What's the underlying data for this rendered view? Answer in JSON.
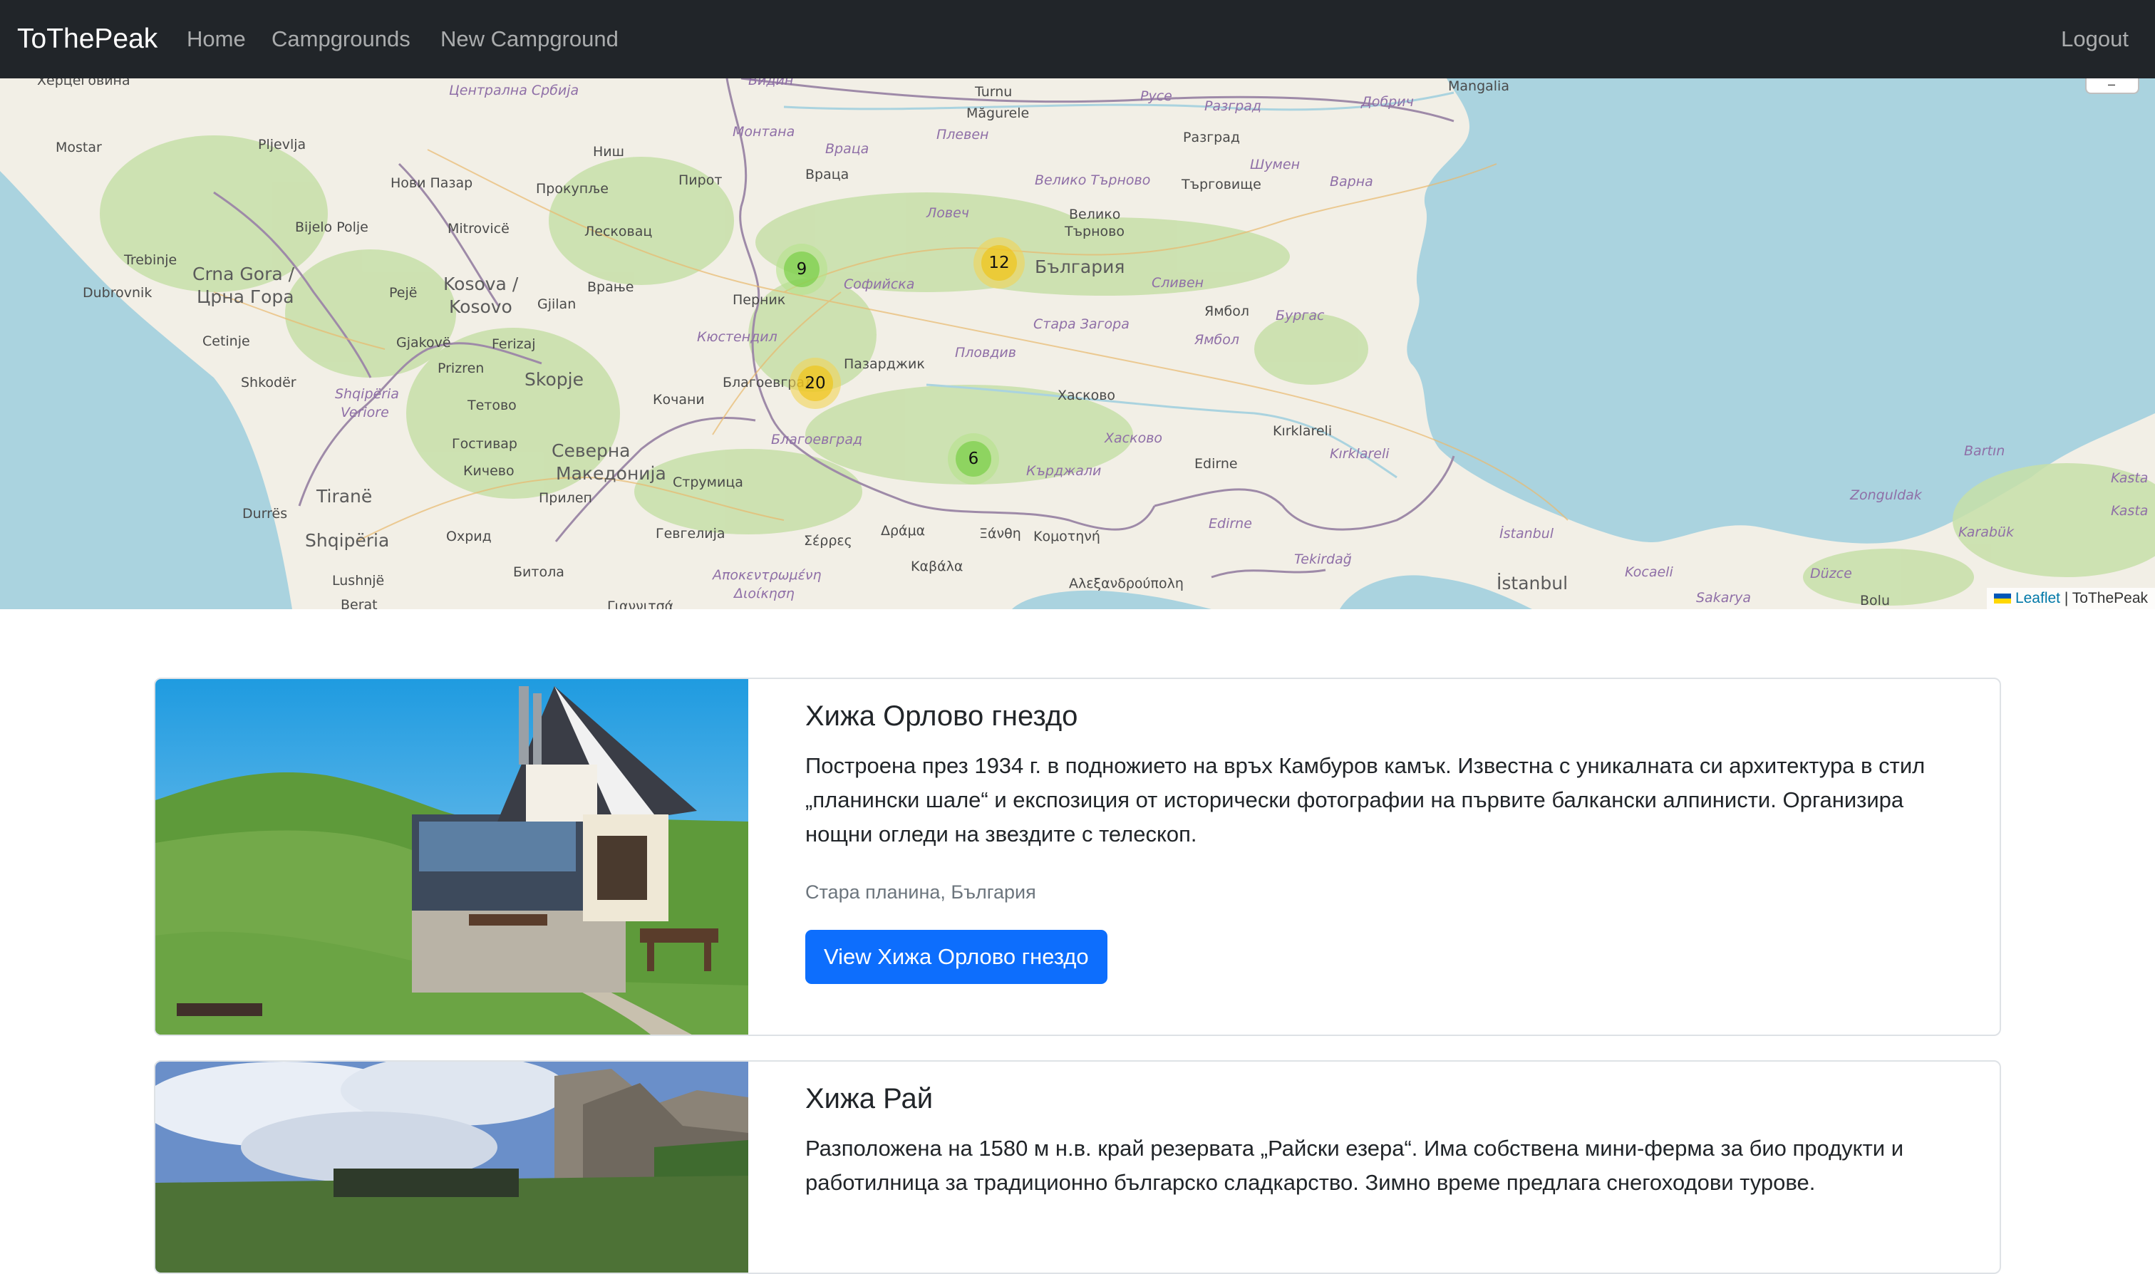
{
  "nav": {
    "brand": "ToThePeak",
    "links": [
      {
        "label": "Home"
      },
      {
        "label": "Campgrounds"
      },
      {
        "label": "New Campground"
      }
    ],
    "logout": "Logout",
    "bg_color": "#212529"
  },
  "map": {
    "clusters": [
      {
        "count": "9",
        "level": "small"
      },
      {
        "count": "12",
        "level": "medium"
      },
      {
        "count": "20",
        "level": "medium"
      },
      {
        "count": "6",
        "level": "small"
      }
    ],
    "labels": {
      "hercegovina": "Херцеговина",
      "centralna_srbija": "Централна Србија",
      "vidin": "Видин",
      "turnu": "Turnu",
      "magurele": "Măgurele",
      "ruse": "Русе",
      "razgrad_reg": "Разград",
      "dobrich": "Добрич",
      "mangalia": "Mangalia",
      "mostar": "Mostar",
      "pljevlja": "Pljevlja",
      "nis": "Ниш",
      "montana": "Монтана",
      "vraca_reg": "Враца",
      "pleven": "Плевен",
      "razgrad": "Разград",
      "shumen": "Шумен",
      "novi_pazar": "Нови Пазар",
      "prokuplje": "Прокупље",
      "pirot": "Пирот",
      "vraca": "Враца",
      "veliko_tarnovo_reg": "Велико Търново",
      "targovishte": "Търговище",
      "varna": "Варна",
      "bijelo_polje": "Bijelo Polje",
      "mitrovice": "Mitrovicë",
      "leskovac": "Лесковац",
      "lovech": "Ловеч",
      "veliko": "Велико",
      "tarnovo": "Търново",
      "trebinje": "Trebinje",
      "crna_gora": "Crna Gora /",
      "crna_gora_cyr": "Црна Гора",
      "kosova": "Kosova /",
      "kosovo": "Kosovo",
      "vranje": "Врање",
      "sofiyska": "Софийска",
      "balgaria": "България",
      "sliven_reg": "Сливен",
      "dubrovnik": "Dubrovnik",
      "peje": "Pejë",
      "gjilan": "Gjilan",
      "pernik": "Перник",
      "kyustendil": "Кюстендил",
      "stara_zagora": "Стара Загора",
      "yambol": "Ямбол",
      "burgas": "Бургас",
      "cetinje": "Cetinje",
      "gjakove": "Gjakovë",
      "ferizaj": "Ferizaj",
      "plovdiv": "Пловдив",
      "yambol_reg": "Ямбол",
      "shkoder": "Shkodër",
      "prizren": "Prizren",
      "skopje": "Skopje",
      "blagoevgrad": "Благоевград",
      "pazardzhik": "Пазарджик",
      "shqiperia": "Shqipëria",
      "veriore": "Veriore",
      "tetovo": "Тетово",
      "kochani": "Кочани",
      "haskovo": "Хасково",
      "gostivar": "Гостивар",
      "severna": "Северна",
      "makedonija": "Македонија",
      "blagoevgrad_reg": "Благоевград",
      "haskovo_reg": "Хасково",
      "kirklareli": "Kırklareli",
      "kichevo": "Кичево",
      "strumica": "Струмица",
      "kardzhali": "Кърджали",
      "edirne": "Edirne",
      "kirklareli_reg": "Kırklareli",
      "bartin": "Bartın",
      "tirane": "Tiranë",
      "prilep": "Прилеп",
      "zonguldak": "Zonguldak",
      "durres": "Durrës",
      "edirne_reg": "Edirne",
      "kasta": "Kasta",
      "shqiperia2": "Shqipëria",
      "ohrid": "Охрид",
      "gevgelija": "Гевгелија",
      "serres": "Σέρρες",
      "drama": "Δράμα",
      "xanthi": "Ξάνθη",
      "komotini": "Κομοτηνή",
      "istanbul_reg": "İstanbul",
      "karabuk": "Karabük",
      "bitola": "Битола",
      "apokentromeni": "Αποκεντρωμένη",
      "dioikisi": "Διοίκηση",
      "kavala": "Καβάλα",
      "tekirdag": "Tekirdağ",
      "kocaeli": "Kocaeli",
      "duzce": "Düzce",
      "lushnje": "Lushnjë",
      "alexandroupoli": "Αλεξανδρούπολη",
      "istanbul": "İstanbul",
      "sakarya": "Sakarya",
      "bolu": "Bolu",
      "kasta2": "Kasta",
      "berat": "Berat",
      "giannitsa": "Γιαννιτσά"
    },
    "zoom_out": "–",
    "attribution": {
      "leaflet": "Leaflet",
      "separator": " | ",
      "owner": "ToThePeak"
    }
  },
  "campgrounds": [
    {
      "title": "Хижа Орлово гнездо",
      "description": "Построена през 1934 г. в подножието на връх Камбуров камък. Известна с уникалната си архитектура в стил „планински шале“ и експозиция от исторически фотографии на първите балкански алпинисти. Организира нощни огледи на звездите с телескоп.",
      "location": "Стара планина, България",
      "button": "View Хижа Орлово гнездо"
    },
    {
      "title": "Хижа Рай",
      "description": "Разположена на 1580 м н.в. край резервата „Райски езера“. Има собствена мини-ферма за био продукти и работилница за традиционно българско сладкарство. Зимно време предлага снегоходови турове.",
      "location": "",
      "button": ""
    }
  ],
  "colors": {
    "primary": "#0d6efd",
    "muted": "#6c757d",
    "border": "#dee2e6"
  }
}
